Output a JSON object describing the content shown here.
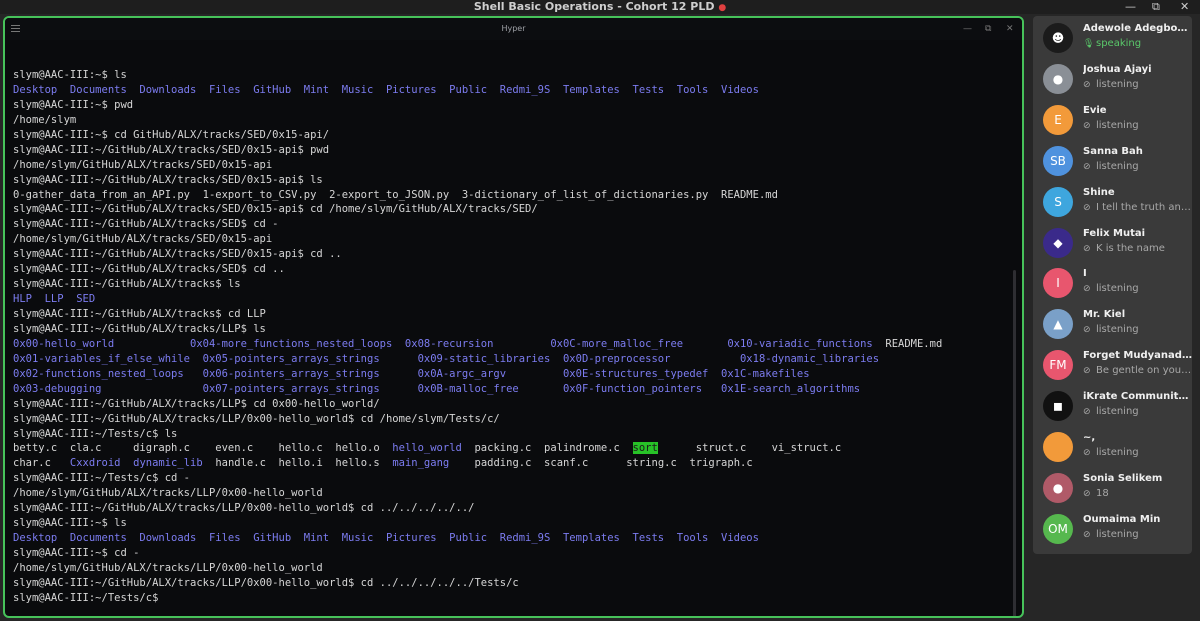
{
  "meeting": {
    "title": "Shell Basic Operations - Cohort 12 PLD",
    "recording_icon": "record-dot"
  },
  "window_controls": {
    "minimize": "—",
    "restore": "⧉",
    "close": "✕"
  },
  "terminal": {
    "app_title": "Hyper",
    "controls": {
      "minimize": "—",
      "restore": "⧉",
      "close": "✕"
    },
    "lines": [
      [
        {
          "t": "slym@AAC-III:~$ ls"
        }
      ],
      [
        {
          "t": "Desktop  Documents  Downloads  Files  GitHub  Mint  Music  Pictures  Public  Redmi_9S  Templates  Tests  Tools  Videos",
          "c": "dir"
        }
      ],
      [
        {
          "t": "slym@AAC-III:~$ pwd"
        }
      ],
      [
        {
          "t": "/home/slym"
        }
      ],
      [
        {
          "t": "slym@AAC-III:~$ cd GitHub/ALX/tracks/SED/0x15-api/"
        }
      ],
      [
        {
          "t": "slym@AAC-III:~/GitHub/ALX/tracks/SED/0x15-api$ pwd"
        }
      ],
      [
        {
          "t": "/home/slym/GitHub/ALX/tracks/SED/0x15-api"
        }
      ],
      [
        {
          "t": "slym@AAC-III:~/GitHub/ALX/tracks/SED/0x15-api$ ls"
        }
      ],
      [
        {
          "t": "0-gather_data_from_an_API.py  1-export_to_CSV.py  2-export_to_JSON.py  3-dictionary_of_list_of_dictionaries.py  README.md"
        }
      ],
      [
        {
          "t": "slym@AAC-III:~/GitHub/ALX/tracks/SED/0x15-api$ cd /home/slym/GitHub/ALX/tracks/SED/"
        }
      ],
      [
        {
          "t": "slym@AAC-III:~/GitHub/ALX/tracks/SED$ cd -"
        }
      ],
      [
        {
          "t": "/home/slym/GitHub/ALX/tracks/SED/0x15-api"
        }
      ],
      [
        {
          "t": "slym@AAC-III:~/GitHub/ALX/tracks/SED/0x15-api$ cd .."
        }
      ],
      [
        {
          "t": "slym@AAC-III:~/GitHub/ALX/tracks/SED$ cd .."
        }
      ],
      [
        {
          "t": "slym@AAC-III:~/GitHub/ALX/tracks$ ls"
        }
      ],
      [
        {
          "t": "HLP  LLP  SED",
          "c": "dir"
        }
      ],
      [
        {
          "t": "slym@AAC-III:~/GitHub/ALX/tracks$ cd LLP"
        }
      ],
      [
        {
          "t": "slym@AAC-III:~/GitHub/ALX/tracks/LLP$ ls"
        }
      ],
      [
        {
          "t": "0x00-hello_world            0x04-more_functions_nested_loops  0x08-recursion         0x0C-more_malloc_free       0x10-variadic_functions  ",
          "c": "dir"
        },
        {
          "t": "README.md"
        }
      ],
      [
        {
          "t": "0x01-variables_if_else_while  0x05-pointers_arrays_strings      0x09-static_libraries  0x0D-preprocessor           0x18-dynamic_libraries",
          "c": "dir"
        }
      ],
      [
        {
          "t": "0x02-functions_nested_loops   0x06-pointers_arrays_strings      0x0A-argc_argv         0x0E-structures_typedef  0x1C-makefiles",
          "c": "dir"
        }
      ],
      [
        {
          "t": "0x03-debugging                0x07-pointers_arrays_strings      0x0B-malloc_free       0x0F-function_pointers   0x1E-search_algorithms",
          "c": "dir"
        }
      ],
      [
        {
          "t": "slym@AAC-III:~/GitHub/ALX/tracks/LLP$ cd 0x00-hello_world/"
        }
      ],
      [
        {
          "t": "slym@AAC-III:~/GitHub/ALX/tracks/LLP/0x00-hello_world$ cd /home/slym/Tests/c/"
        }
      ],
      [
        {
          "t": "slym@AAC-III:~/Tests/c$ ls"
        }
      ],
      [
        {
          "t": "betty.c  cla.c     digraph.c    even.c    hello.c  hello.o  "
        },
        {
          "t": "hello_world",
          "c": "dir"
        },
        {
          "t": "  packing.c  palindrome.c  "
        },
        {
          "t": "sort",
          "c": "hl"
        },
        {
          "t": "      struct.c    vi_struct.c"
        }
      ],
      [
        {
          "t": "char.c   "
        },
        {
          "t": "Cxxdroid  dynamic_lib",
          "c": "dir"
        },
        {
          "t": "  handle.c  hello.i  hello.s  "
        },
        {
          "t": "main_gang",
          "c": "dir"
        },
        {
          "t": "    padding.c  scanf.c      string.c  trigraph.c"
        }
      ],
      [
        {
          "t": "slym@AAC-III:~/Tests/c$ cd -"
        }
      ],
      [
        {
          "t": "/home/slym/GitHub/ALX/tracks/LLP/0x00-hello_world"
        }
      ],
      [
        {
          "t": "slym@AAC-III:~/GitHub/ALX/tracks/LLP/0x00-hello_world$ cd ../../../../../"
        }
      ],
      [
        {
          "t": "slym@AAC-III:~$ ls"
        }
      ],
      [
        {
          "t": "Desktop  Documents  Downloads  Files  GitHub  Mint  Music  Pictures  Public  Redmi_9S  Templates  Tests  Tools  Videos",
          "c": "dir"
        }
      ],
      [
        {
          "t": "slym@AAC-III:~$ cd -"
        }
      ],
      [
        {
          "t": "/home/slym/GitHub/ALX/tracks/LLP/0x00-hello_world"
        }
      ],
      [
        {
          "t": "slym@AAC-III:~/GitHub/ALX/tracks/LLP/0x00-hello_world$ cd ../../../../../Tests/c"
        }
      ],
      [
        {
          "t": "slym@AAC-III:~/Tests/c$"
        }
      ]
    ]
  },
  "participants": [
    {
      "name": "Adewole Adegboyega",
      "status": "speaking",
      "status_icon": "mic-icon",
      "initials": "",
      "color": "#1b1b1b",
      "speaking": true
    },
    {
      "name": "Joshua Ajayi",
      "status": "listening",
      "status_icon": "muted-mic-icon",
      "initials": "",
      "color": "#8a8f96"
    },
    {
      "name": "Evie",
      "status": "listening",
      "status_icon": "muted-mic-icon",
      "initials": "E",
      "color": "#f29a3a"
    },
    {
      "name": "Sanna Bah",
      "status": "listening",
      "status_icon": "muted-mic-icon",
      "initials": "SB",
      "color": "#4f92de"
    },
    {
      "name": "Shine",
      "status": "I tell the truth and...",
      "status_icon": "muted-mic-icon",
      "initials": "S",
      "color": "#3ea6de"
    },
    {
      "name": "Felix Mutai",
      "status": "K is the name",
      "status_icon": "muted-mic-icon",
      "initials": "",
      "color": "#3a2a8a"
    },
    {
      "name": "I",
      "status": "listening",
      "status_icon": "muted-mic-icon",
      "initials": "I",
      "color": "#e8566e"
    },
    {
      "name": "Mr. Kiel",
      "status": "listening",
      "status_icon": "muted-mic-icon",
      "initials": "",
      "color": "#7aa0c8"
    },
    {
      "name": "Forget Mudyanadzo",
      "status": "Be gentle on yourself",
      "status_icon": "muted-mic-icon",
      "initials": "FM",
      "color": "#e8566e"
    },
    {
      "name": "iKrate Community ...",
      "status": "listening",
      "status_icon": "muted-mic-icon",
      "initials": "",
      "color": "#111111"
    },
    {
      "name": "~,",
      "status": "listening",
      "status_icon": "muted-mic-icon",
      "initials": "",
      "color": "#f29a3a"
    },
    {
      "name": "Sonia Selikem",
      "status": "18",
      "status_icon": "muted-mic-icon",
      "initials": "",
      "color": "#b05a68"
    },
    {
      "name": "Oumaima Min",
      "status": "listening",
      "status_icon": "muted-mic-icon",
      "initials": "OM",
      "color": "#56b84e"
    }
  ]
}
